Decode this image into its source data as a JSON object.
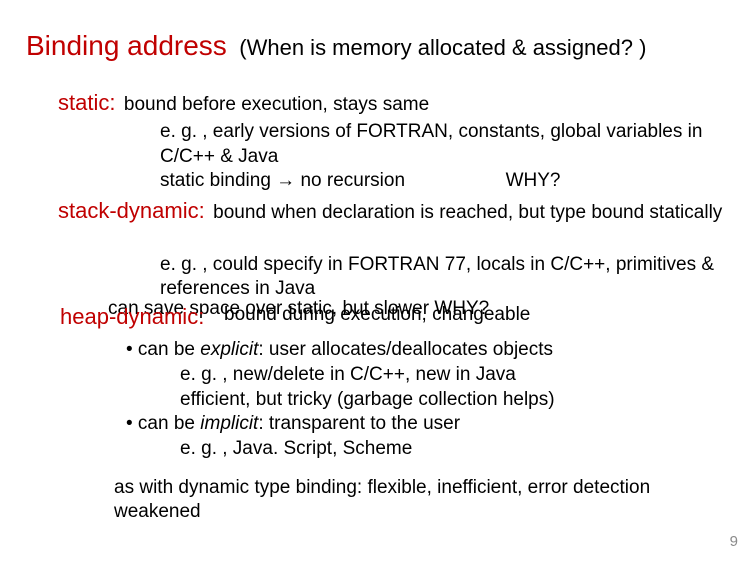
{
  "title": "Binding address",
  "subtitle": "(When is memory allocated & assigned? )",
  "static": {
    "head": "static:",
    "desc": "bound before execution, stays same",
    "line1": "e. g. , early versions of FORTRAN, constants, global variables in C/C++ & Java",
    "line2a": "static binding → no recursion",
    "line2b": "WHY?"
  },
  "stackdyn": {
    "head": "stack-dynamic:",
    "desc": "bound when declaration is reached, but type bound statically",
    "line1": "e. g. , could specify in FORTRAN 77, locals in C/C++, primitives & references in Java"
  },
  "overlap": {
    "top": "can save space over static, but slower    WHY?",
    "head": "heap-dynamic:",
    "desc": "bound during execution, changeable"
  },
  "bullets": {
    "b1": "• can be",
    "b1i": "explicit",
    "b1rest": ":  user allocates/deallocates objects",
    "b1s1": "e. g. , new/delete in C/C++, new in Java",
    "b1s2": "efficient, but tricky (garbage collection helps)",
    "b2": "• can be",
    "b2i": "implicit",
    "b2rest": ":  transparent to the user",
    "b2s1": "e. g. , Java. Script, Scheme"
  },
  "footer": "as with dynamic type binding: flexible, inefficient, error detection weakened",
  "page": "9"
}
